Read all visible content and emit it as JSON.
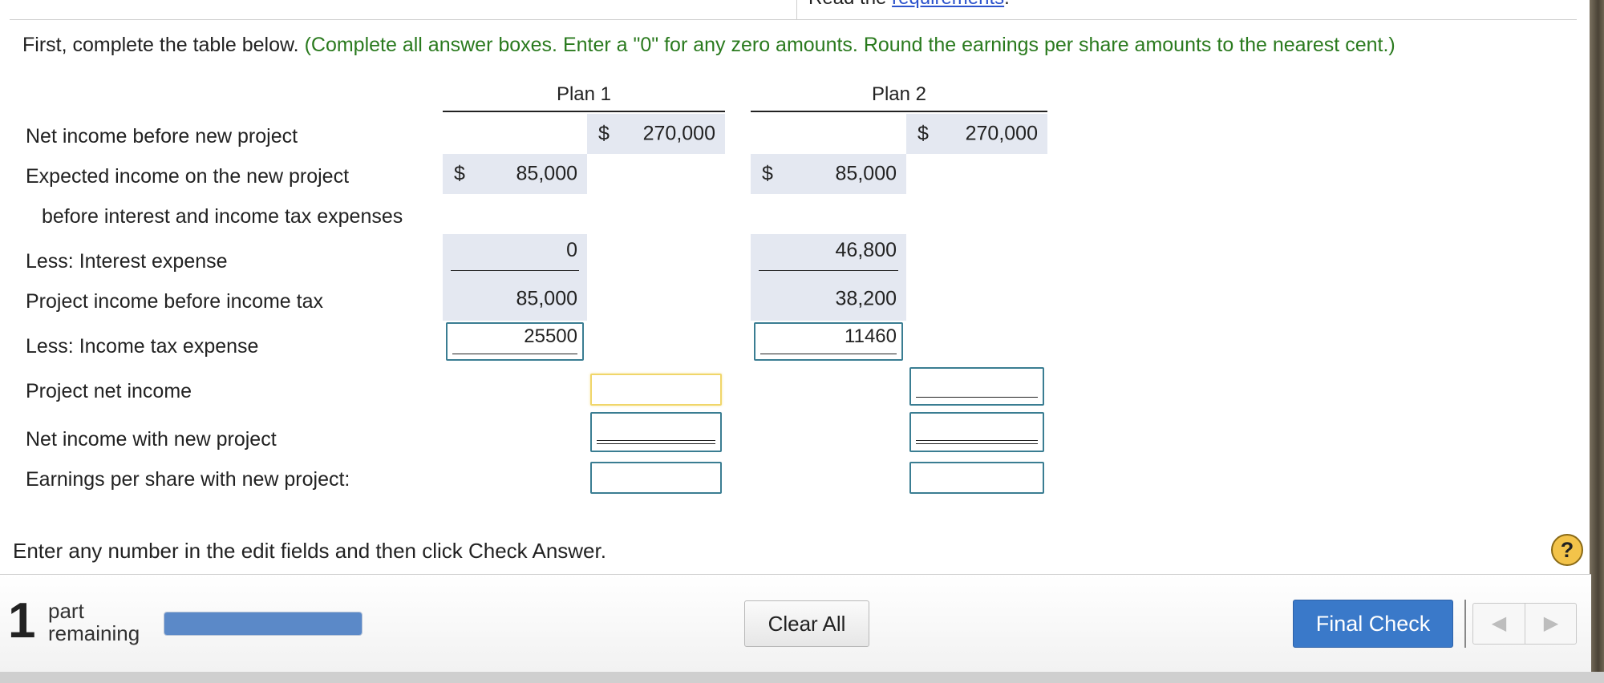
{
  "top_fragment": {
    "prefix": "Read the ",
    "link": "requirements",
    "suffix": "."
  },
  "instructions": {
    "lead": "First, complete the table below.",
    "hint": "(Complete all answer boxes. Enter a \"0\" for any zero amounts. Round the earnings per share amounts to the nearest cent.)"
  },
  "table": {
    "plan1_header": "Plan 1",
    "plan2_header": "Plan 2",
    "rows": {
      "net_income_before": "Net income before new project",
      "expected_income_1": "Expected income on the new project",
      "expected_income_2": "before interest and income tax expenses",
      "interest": "Less: Interest expense",
      "pretax": "Project income before income tax",
      "tax": "Less: Income tax expense",
      "project_net": "Project net income",
      "net_with_project": "Net income with new project",
      "eps": "Earnings per share with new project:"
    },
    "currency": "$",
    "plan1": {
      "net_income_before": "270,000",
      "expected_income": "85,000",
      "interest": "0",
      "pretax": "85,000",
      "tax_input": "25500"
    },
    "plan2": {
      "net_income_before": "270,000",
      "expected_income": "85,000",
      "interest": "46,800",
      "pretax": "38,200",
      "tax_input": "11460"
    }
  },
  "enter_message": "Enter any number in the edit fields and then click Check Answer.",
  "help_label": "?",
  "footer": {
    "parts_count": "1",
    "parts_line1": "part",
    "parts_line2": "remaining",
    "progress_percent": 100,
    "clear_all": "Clear All",
    "final_check": "Final Check",
    "prev_icon": "◀",
    "next_icon": "▶"
  },
  "colors": {
    "hint_green": "#2a7a1e",
    "accent_blue": "#3a79c9",
    "input_border": "#3a7d92",
    "active_border": "#f0d66a"
  }
}
